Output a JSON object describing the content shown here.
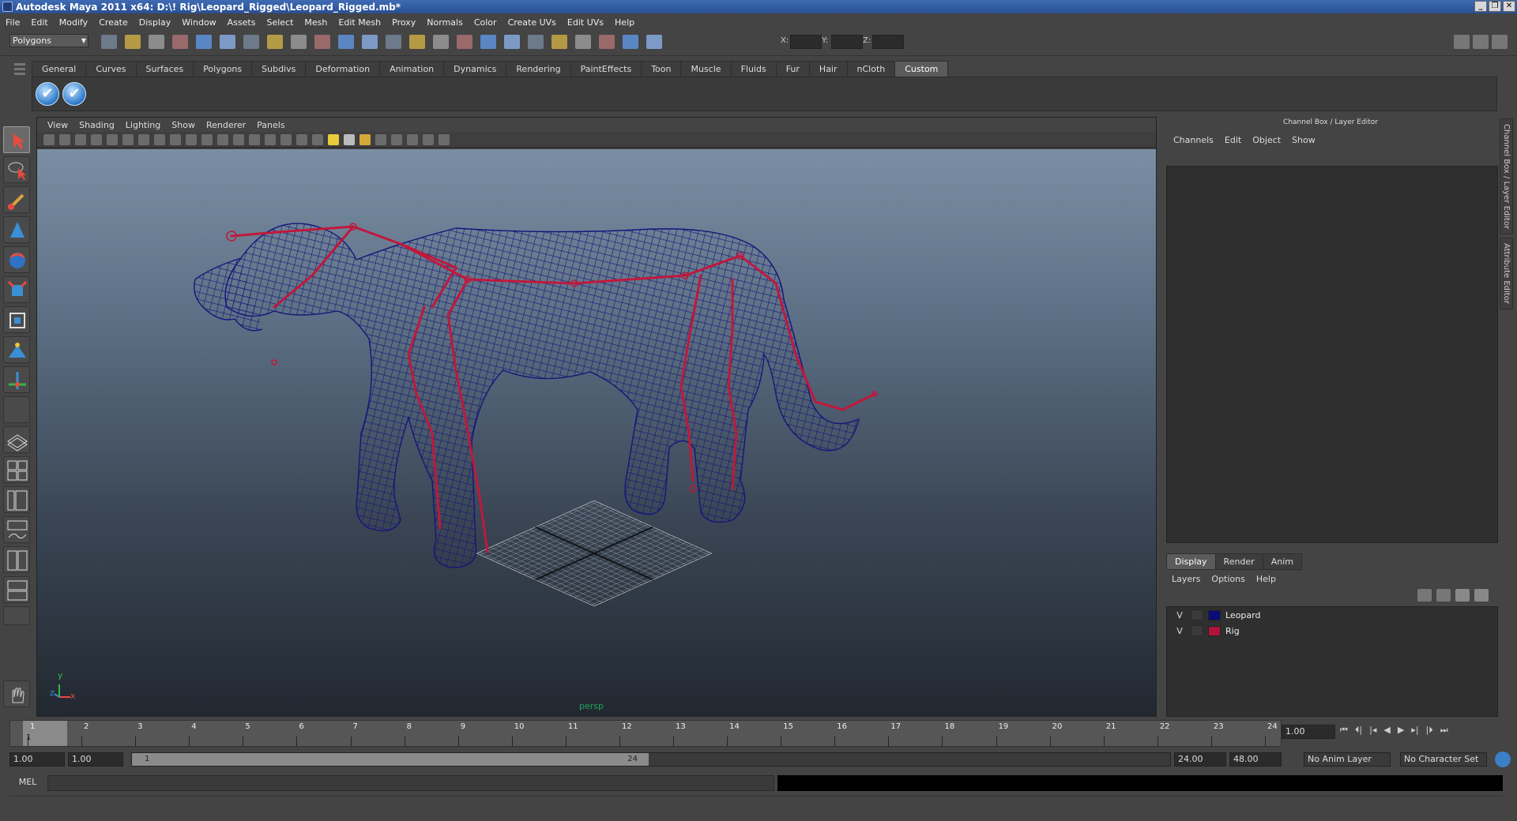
{
  "window": {
    "title": "Autodesk Maya 2011 x64: D:\\! Rig\\Leopard_Rigged\\Leopard_Rigged.mb*"
  },
  "menubar": [
    "File",
    "Edit",
    "Modify",
    "Create",
    "Display",
    "Window",
    "Assets",
    "Select",
    "Mesh",
    "Edit Mesh",
    "Proxy",
    "Normals",
    "Color",
    "Create UVs",
    "Edit UVs",
    "Help"
  ],
  "toolbar": {
    "mode": "Polygons",
    "x_label": "X:",
    "y_label": "Y:",
    "z_label": "Z:"
  },
  "shelf": {
    "tabs": [
      "General",
      "Curves",
      "Surfaces",
      "Polygons",
      "Subdivs",
      "Deformation",
      "Animation",
      "Dynamics",
      "Rendering",
      "PaintEffects",
      "Toon",
      "Muscle",
      "Fluids",
      "Fur",
      "Hair",
      "nCloth",
      "Custom"
    ],
    "active_tab": "Custom"
  },
  "viewport": {
    "menu": [
      "View",
      "Shading",
      "Lighting",
      "Show",
      "Renderer",
      "Panels"
    ],
    "camera": "persp",
    "axis_y": "y",
    "axis_x": "x",
    "axis_z": "z"
  },
  "channel_box": {
    "title": "Channel Box / Layer Editor",
    "menu": [
      "Channels",
      "Edit",
      "Object",
      "Show"
    ]
  },
  "layer_editor": {
    "tabs": [
      "Display",
      "Render",
      "Anim"
    ],
    "active_tab": "Display",
    "menu": [
      "Layers",
      "Options",
      "Help"
    ],
    "layers": [
      {
        "visible": "V",
        "name": "Leopard",
        "color": "#0b0b7a"
      },
      {
        "visible": "V",
        "name": "Rig",
        "color": "#b0123a"
      }
    ]
  },
  "side_tabs": [
    "Channel Box / Layer Editor",
    "Attribute Editor"
  ],
  "time_slider": {
    "ticks": [
      "1",
      "2",
      "3",
      "4",
      "5",
      "6",
      "7",
      "8",
      "9",
      "10",
      "11",
      "12",
      "13",
      "14",
      "15",
      "16",
      "17",
      "18",
      "19",
      "20",
      "21",
      "22",
      "23",
      "24"
    ],
    "current_frame": "1",
    "current_field": "1.00"
  },
  "range_slider": {
    "start_field": "1.00",
    "anim_start": "1.00",
    "handle_start": "1",
    "handle_end": "24",
    "end_field": "24.00",
    "anim_end": "48.00",
    "anim_layer": "No Anim Layer",
    "char_set": "No Character Set"
  },
  "command_line": {
    "label": "MEL"
  },
  "colors": {
    "mesh": "#15157a",
    "rig": "#c0183c",
    "viewport_top": "#7b8ea3",
    "viewport_bottom": "#222830"
  }
}
